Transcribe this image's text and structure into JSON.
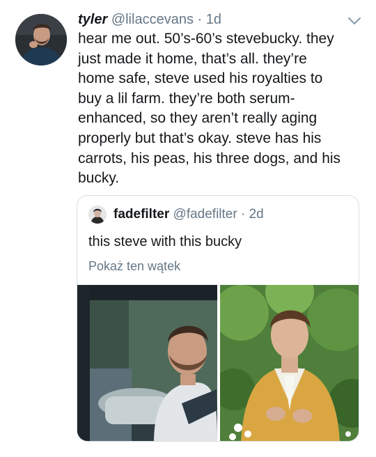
{
  "tweet": {
    "display_name": "tyler",
    "handle": "@lilaccevans",
    "separator": "·",
    "time": "1d",
    "text_lines": [
      "hear me out. 50’s-60’s stevebucky. they",
      "just made it home, that’s all. they’re",
      "home safe, steve used his royalties to",
      "buy a lil farm. they’re both serum-",
      "enhanced, so they aren’t really aging",
      "properly but that’s okay. steve has his",
      "carrots, his peas, his three dogs, and his",
      "bucky."
    ]
  },
  "quoted": {
    "display_name": "fadefilter",
    "handle": "@fadefilter",
    "separator": "·",
    "time": "2d",
    "text": "this steve with this bucky",
    "show_thread": "Pokaż ten wątek"
  },
  "icons": {
    "menu": "chevron-down-icon"
  },
  "colors": {
    "text": "#14171a",
    "muted": "#657786",
    "border": "#d8dee3"
  }
}
